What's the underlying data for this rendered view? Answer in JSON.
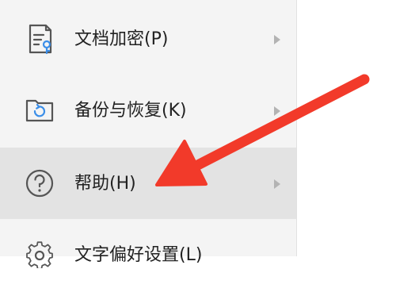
{
  "menu": {
    "items": [
      {
        "label": "文档加密(P)",
        "icon": "document-lock-icon",
        "has_submenu": true
      },
      {
        "label": "备份与恢复(K)",
        "icon": "backup-restore-icon",
        "has_submenu": true
      },
      {
        "label": "帮助(H)",
        "icon": "help-icon",
        "has_submenu": true,
        "highlighted": true
      },
      {
        "label": "文字偏好设置(L)",
        "icon": "settings-gear-icon",
        "has_submenu": true
      }
    ]
  },
  "annotation": {
    "arrow_color": "#f23a2a"
  },
  "colors": {
    "menu_background": "#f4f4f4",
    "highlight_background": "#e3e3e3",
    "icon_stroke": "#555555",
    "icon_accent": "#3b8ee8",
    "text": "#222222"
  }
}
